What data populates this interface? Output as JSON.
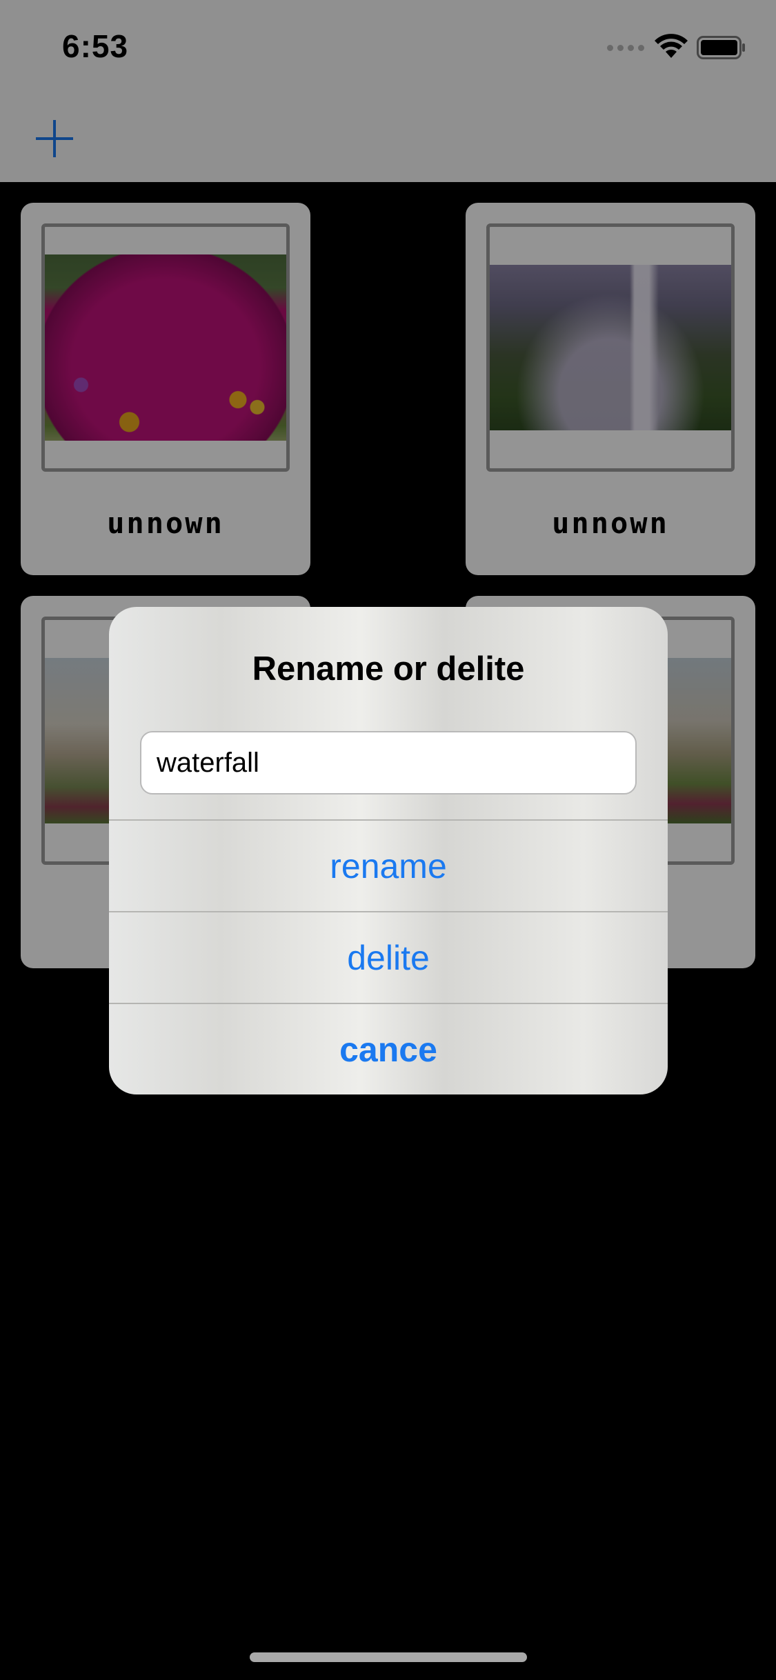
{
  "status_bar": {
    "time": "6:53"
  },
  "nav": {
    "add_icon": "plus-icon"
  },
  "cards": [
    {
      "name": "unnown",
      "photo": "magenta-flowers"
    },
    {
      "name": "unnown",
      "photo": "waterfall-cliffs"
    },
    {
      "name": "",
      "photo": "dune-grass"
    },
    {
      "name": "",
      "photo": "dune-grass"
    }
  ],
  "alert": {
    "title": "Rename or delite",
    "field_value": "waterfall",
    "rename_label": "rename",
    "delite_label": "delite",
    "cancel_label": "cance"
  },
  "colors": {
    "action_blue": "#1a79f0",
    "card_bg": "#ffffff",
    "frame_border": "#9b9b9b"
  }
}
